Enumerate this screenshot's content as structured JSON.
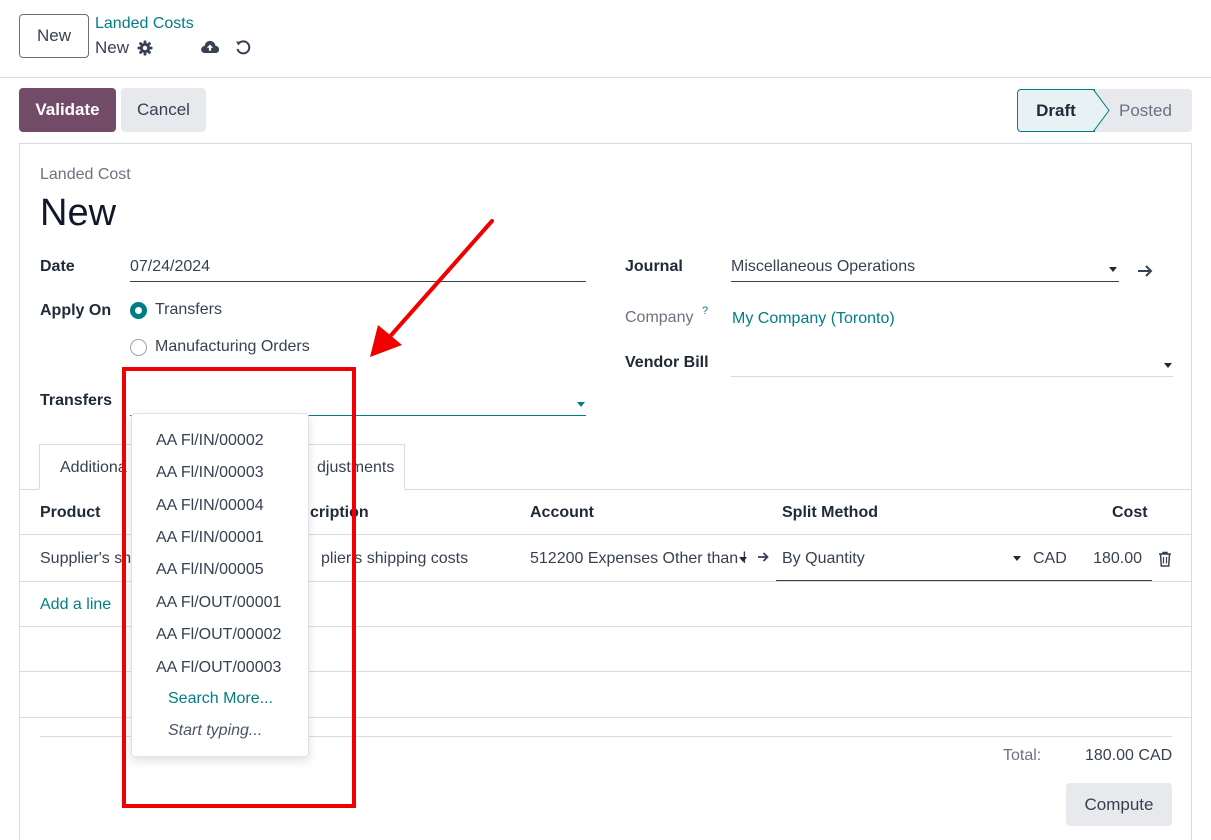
{
  "header": {
    "new_button": "New",
    "breadcrumb_parent": "Landed Costs",
    "breadcrumb_current": "New"
  },
  "actions": {
    "validate": "Validate",
    "cancel": "Cancel"
  },
  "statusbar": {
    "stages": [
      "Draft",
      "Posted"
    ],
    "active": "Draft"
  },
  "form": {
    "label": "Landed Cost",
    "name": "New",
    "date_label": "Date",
    "date_value": "07/24/2024",
    "apply_on_label": "Apply On",
    "apply_on_options": [
      "Transfers",
      "Manufacturing Orders"
    ],
    "apply_on_selected": "Transfers",
    "transfers_label": "Transfers",
    "transfers_value": "",
    "journal_label": "Journal",
    "journal_value": "Miscellaneous Operations",
    "company_label": "Company",
    "company_help": "?",
    "company_value": "My Company (Toronto)",
    "vendor_bill_label": "Vendor Bill",
    "vendor_bill_value": ""
  },
  "tabs": {
    "tab1_visible": "Additiona",
    "tab2_visible": "djustments"
  },
  "table": {
    "headers": [
      "Product",
      "cription",
      "Account",
      "Split Method",
      "Cost"
    ],
    "row": {
      "product": "Supplier's sh",
      "description": "plier's shipping costs",
      "account": "512200 Expenses Other than l",
      "split_method": "By Quantity",
      "currency": "CAD",
      "cost": "180.00"
    },
    "add_line": "Add a line"
  },
  "totals": {
    "label": "Total:",
    "value": "180.00 CAD"
  },
  "compute_button": "Compute",
  "dropdown": {
    "items": [
      "AA Fl/IN/00002",
      "AA Fl/IN/00003",
      "AA Fl/IN/00004",
      "AA Fl/IN/00001",
      "AA Fl/IN/00005",
      "AA Fl/OUT/00001",
      "AA Fl/OUT/00002",
      "AA Fl/OUT/00003"
    ],
    "search_more": "Search More...",
    "start_typing": "Start typing..."
  },
  "colors": {
    "primary": "#714b67",
    "link": "#017e84",
    "annotation": "#f00000"
  }
}
